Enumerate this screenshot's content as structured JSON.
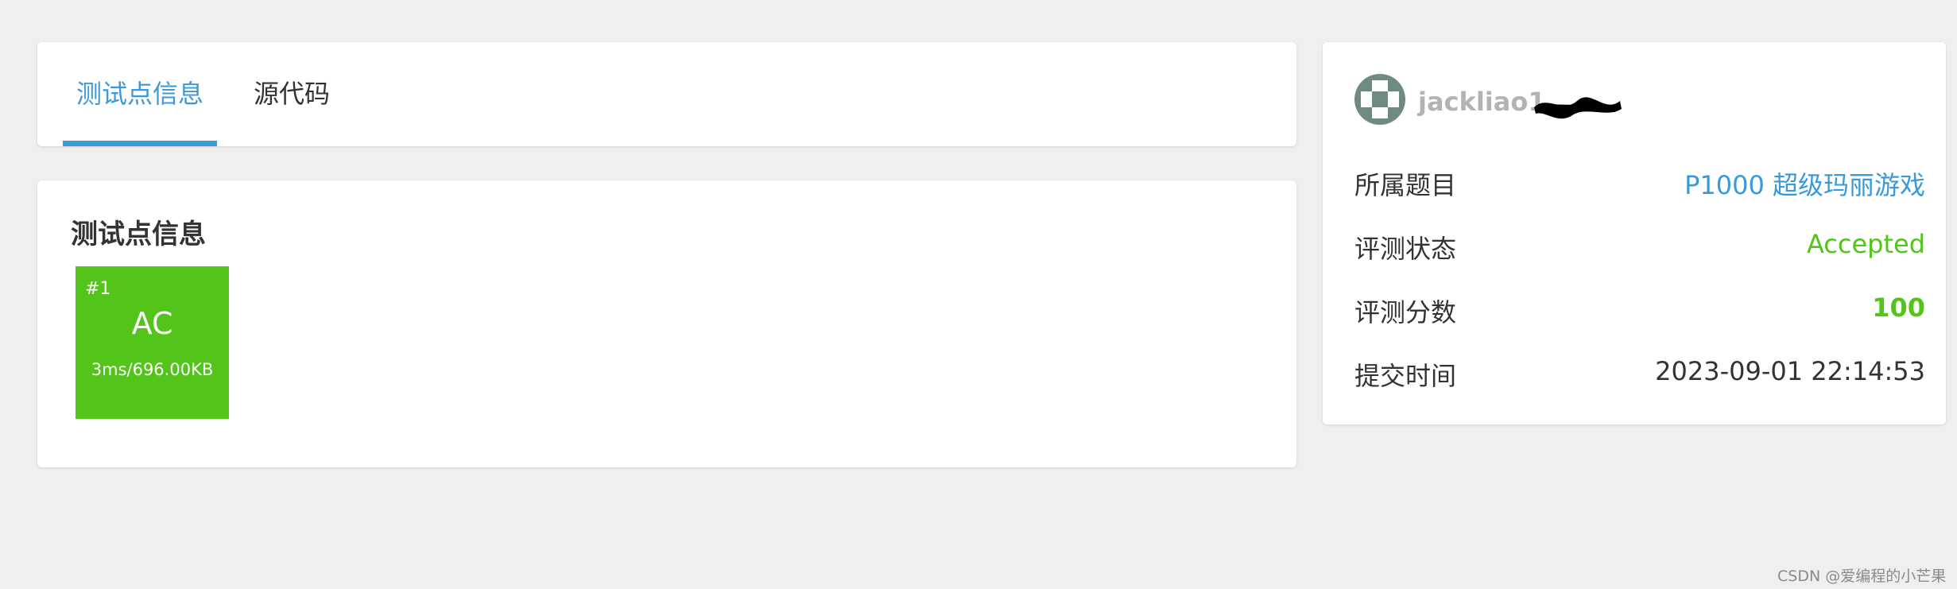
{
  "tabs": [
    {
      "label": "测试点信息",
      "active": true
    },
    {
      "label": "源代码",
      "active": false
    }
  ],
  "cases_section": {
    "title": "测试点信息",
    "cases": [
      {
        "num": "#1",
        "status": "AC",
        "meta": "3ms/696.00KB"
      }
    ]
  },
  "submission": {
    "username": "jackliao1",
    "rows": [
      {
        "label": "所属题目",
        "value": "P1000 超级玛丽游戏"
      },
      {
        "label": "评测状态",
        "value": "Accepted"
      },
      {
        "label": "评测分数",
        "value": "100"
      },
      {
        "label": "提交时间",
        "value": "2023-09-01 22:14:53"
      }
    ]
  },
  "watermark": "CSDN @爱编程的小芒果",
  "colors": {
    "accent": "#3a9ad9",
    "success": "#52c41a",
    "background": "#efefef"
  },
  "icons": {
    "avatar": "identicon-avatar"
  }
}
